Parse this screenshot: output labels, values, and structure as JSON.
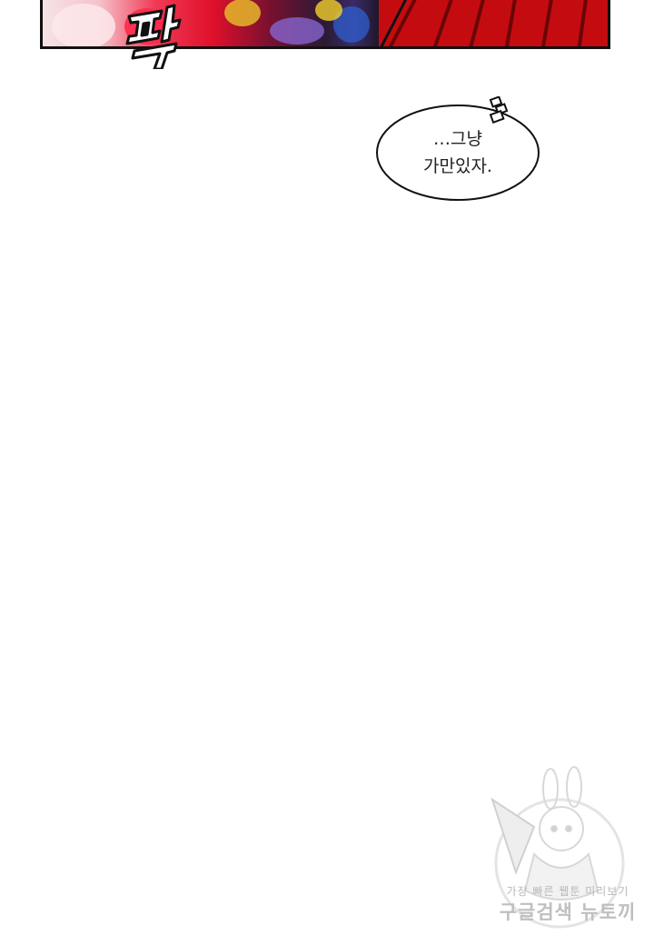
{
  "panel": {
    "sound_effect": "팍"
  },
  "speech_bubble": {
    "line1": "…그냥",
    "line2": "가만있자."
  },
  "watermark": {
    "tagline": "가장 빠른 웹툰 미리보기",
    "brand": "구글검색 뉴토끼"
  },
  "colors": {
    "panel_red": "#cc1010",
    "panel_pink": "#f03a55",
    "outline": "#111111",
    "watermark_gray": "#bfbfbf"
  }
}
